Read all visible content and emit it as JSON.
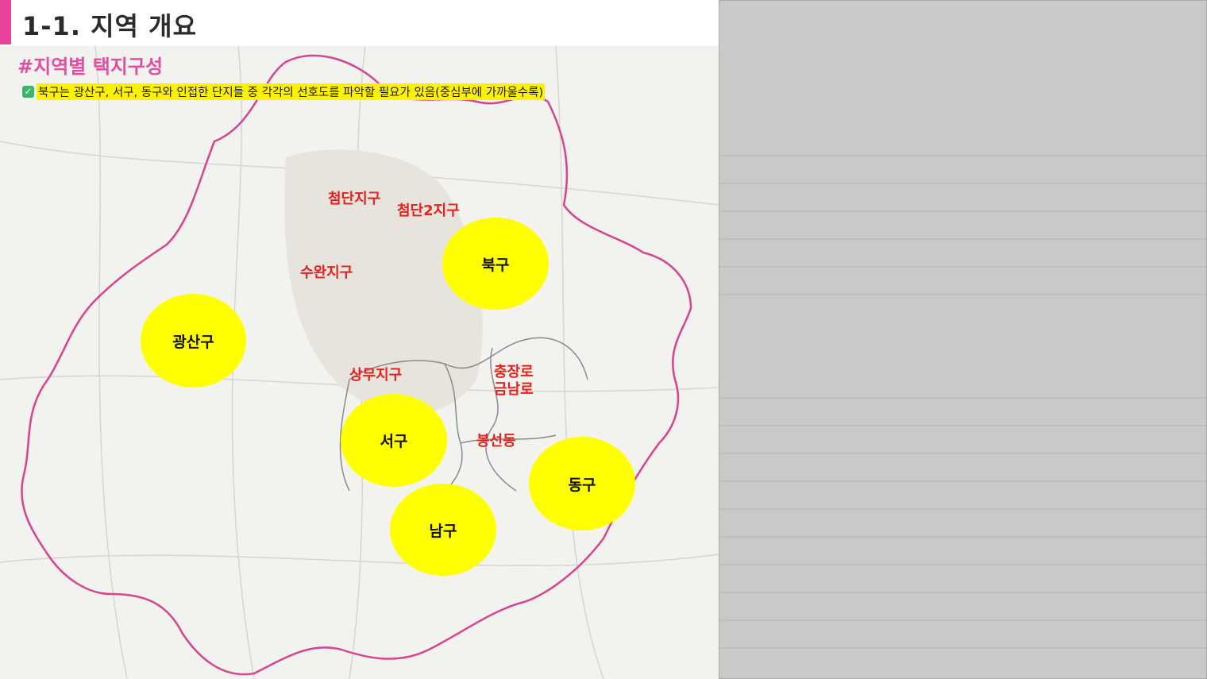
{
  "header": {
    "title": "1-1. 지역 개요"
  },
  "map": {
    "subtitle": "#지역별 택지구성",
    "note": "북구는 광산구, 서구, 동구와 인접한 단지들 중 각각의 선호도를 파악할 필요가 있음(중심부에 가까울수록)",
    "districts": [
      {
        "name": "광산구"
      },
      {
        "name": "북구"
      },
      {
        "name": "서구"
      },
      {
        "name": "남구"
      },
      {
        "name": "동구"
      }
    ],
    "zones": [
      {
        "name": "첨단지구"
      },
      {
        "name": "첨단2지구"
      },
      {
        "name": "수완지구"
      },
      {
        "name": "상무지구"
      },
      {
        "name": "충장로\n금남로"
      },
      {
        "name": "봉선동"
      }
    ],
    "colors": {
      "district_fill": "#ffff00",
      "zone_text": "#e8201c",
      "boundary": "#d9428f",
      "accent": "#e8449e"
    }
  },
  "notes_image": {
    "alt": "handwritten-notes-photo"
  }
}
